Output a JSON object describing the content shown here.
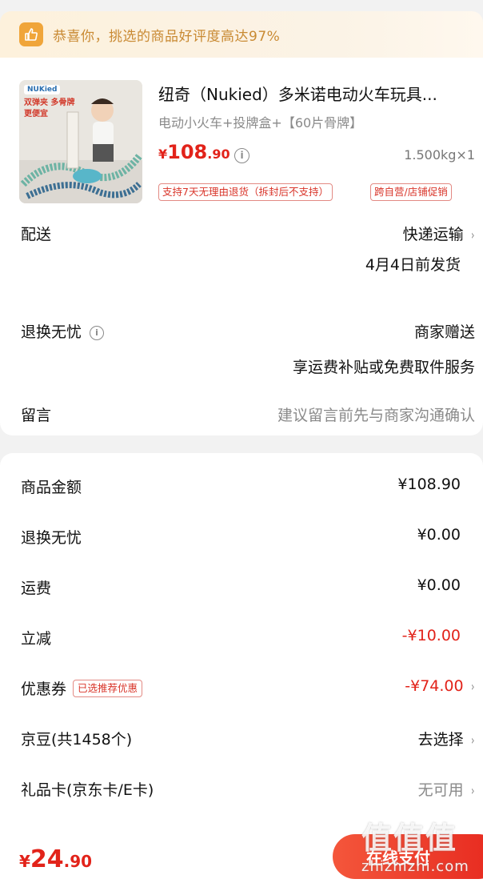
{
  "banner": {
    "text": "恭喜你，挑选的商品好评度高达97%"
  },
  "product": {
    "image_logo": "NUKied",
    "image_promo_1": "双弹夹 多骨牌",
    "image_promo_2": "更便宜",
    "title": "纽奇（Nukied）多米诺电动火车玩具...",
    "spec": "电动小火车+投牌盒+【60片骨牌】",
    "price_currency": "¥",
    "price_int": "108",
    "price_dec": ".90",
    "info_icon": "i",
    "weight_qty": "1.500kg×1",
    "tags": [
      "支持7天无理由退货（拆封后不支持）",
      "跨自营/店铺促销"
    ]
  },
  "delivery": {
    "label": "配送",
    "method": "快递运输",
    "date": "4月4日前发货"
  },
  "return_care": {
    "label": "退换无忧",
    "value": "商家赠送",
    "desc": "享运费补贴或免费取件服务"
  },
  "message": {
    "label": "留言",
    "placeholder": "建议留言前先与商家沟通确认"
  },
  "summary": {
    "goods_label": "商品金额",
    "goods_value": "¥108.90",
    "return_label": "退换无忧",
    "return_value": "¥0.00",
    "shipping_label": "运费",
    "shipping_value": "¥0.00",
    "discount_label": "立减",
    "discount_value": "-¥10.00",
    "coupon_label": "优惠券",
    "coupon_tag": "已选推荐优惠",
    "coupon_value": "-¥74.00",
    "jingdou_label": "京豆(共1458个)",
    "jingdou_value": "去选择",
    "giftcard_label": "礼品卡(京东卡/E卡)",
    "giftcard_value": "无可用"
  },
  "footer": {
    "total_currency": "¥",
    "total_int": "24",
    "total_dec": ".90",
    "pay_label": "在线支付",
    "watermark": "值值值",
    "watermark_domain": "zhizhizhi.com"
  },
  "colors": {
    "accent_red": "#e2231a",
    "banner_text": "#c98a33",
    "banner_icon": "#f0a53a"
  }
}
